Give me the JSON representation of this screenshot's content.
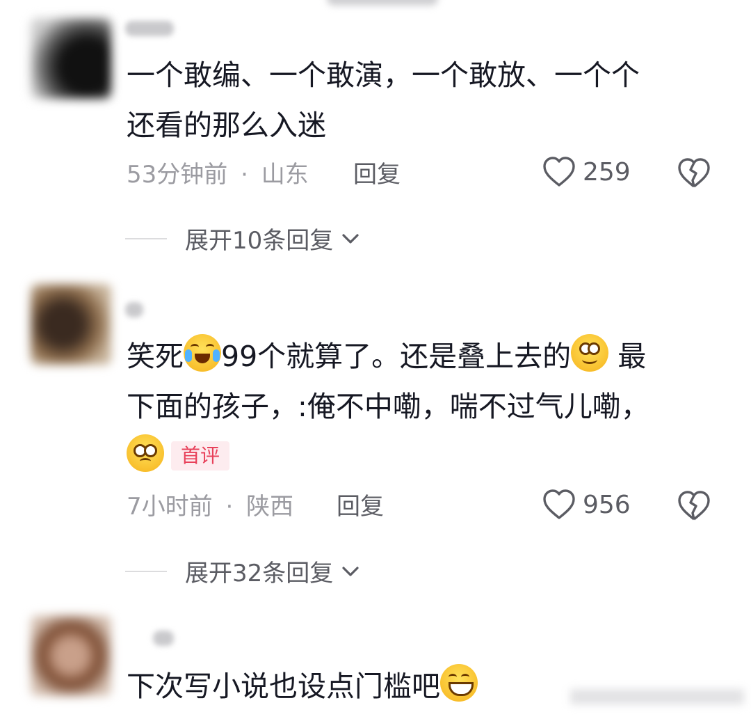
{
  "comments": [
    {
      "text_line1": "一个敢编、一个敢演，一个敢放、一个个",
      "text_line2": "还看的那么入迷",
      "time": "53分钟前",
      "location": "山东",
      "reply_label": "回复",
      "likes": "259",
      "expand_label": "展开10条回复"
    },
    {
      "text_part1": "笑死",
      "text_part2": "99个就算了。还是叠上去的",
      "text_part3": " 最",
      "text_line2": "下面的孩子，:俺不中嘞，喘不过气儿嘞，",
      "badge": "首评",
      "time": "7小时前",
      "location": "陕西",
      "reply_label": "回复",
      "likes": "956",
      "expand_label": "展开32条回复"
    },
    {
      "text": "下次写小说也设点门槛吧"
    }
  ],
  "meta_separator": "·",
  "colors": {
    "badge_bg": "#fdecef",
    "badge_text": "#e8415a",
    "meta": "#9b9ba1"
  },
  "icons": [
    "heart-icon",
    "broken-heart-icon",
    "chevron-down-icon",
    "laughing-crying-emoji-icon",
    "smile-emoji-icon",
    "pleading-emoji-icon",
    "grin-emoji-icon"
  ]
}
